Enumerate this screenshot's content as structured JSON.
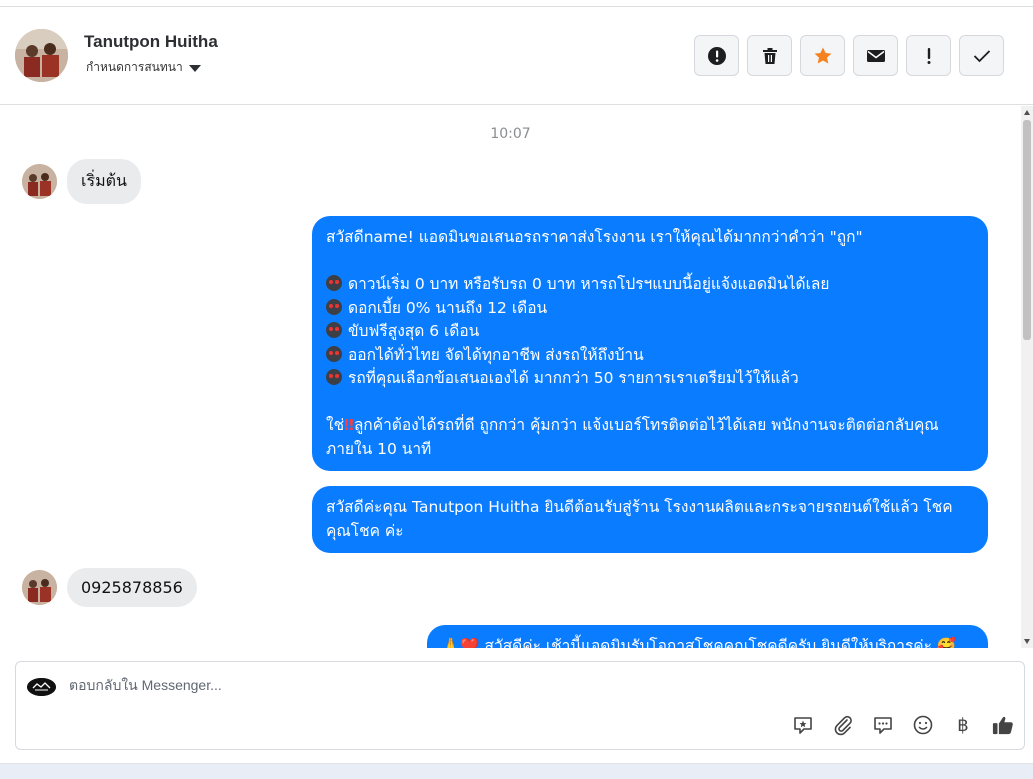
{
  "header": {
    "contact_name": "Tanutpon Huitha",
    "conversation_setting": "กำหนดการสนทนา",
    "actions": [
      {
        "name": "report-icon"
      },
      {
        "name": "trash-icon"
      },
      {
        "name": "star-icon",
        "color": "#f5821f"
      },
      {
        "name": "mail-icon"
      },
      {
        "name": "important-icon"
      },
      {
        "name": "check-icon"
      }
    ]
  },
  "thread": {
    "timestamp": "10:07",
    "messages": [
      {
        "direction": "in",
        "text": "เริ่มต้น"
      },
      {
        "direction": "out",
        "lines": [
          "สวัสดีname! แอดมินขอเสนอรถราคาส่งโรงงาน เราให้คุณได้มากกว่าคำว่า \"ถูก\"",
          "",
          "ดาวน์เริ่ม 0 บาท หรือรับรถ 0 บาท หารถโปรฯแบบนี้อยู่แจ้งแอดมินได้เลย",
          "ดอกเบี้ย 0% นานถึง 12 เดือน",
          "ขับฟรีสูงสุด 6 เดือน",
          "ออกได้ทั่วไทย จัดได้ทุกอาชีพ ส่งรถให้ถึงบ้าน",
          "รถที่คุณเลือกข้อเสนอเองได้ มากกว่า 50 รายการเราเตรียมไว้ให้แล้ว",
          "",
          "ใช่",
          "ลูกค้าต้องได้รถที่ดี ถูกกว่า คุ้มกว่า แจ้งเบอร์โทรติดต่อไว้ได้เลย พนักงานจะติดต่อกลับคุณภายใน 10 นาที"
        ],
        "exclaim": "‼"
      },
      {
        "direction": "out",
        "text": "สวัสดีค่ะคุณ Tanutpon Huitha ยินดีต้อนรับสู่ร้าน โรงงานผลิตและกระจายรถยนต์ใช้แล้ว โชคคุณโชค ค่ะ"
      },
      {
        "direction": "in",
        "text": "0925878856"
      },
      {
        "direction": "out",
        "text": "🙏❤️ สวัสดีค่ะ เช้านี้แอดมินรับโอกาสโชคคุณโชคดีครับ ยินดีให้บริการค่ะ 🥰"
      }
    ]
  },
  "composer": {
    "placeholder": "ตอบกลับใน Messenger...",
    "tools": [
      "saved-reply-icon",
      "attach-icon",
      "chat-icon",
      "emoji-icon",
      "baht-icon",
      "like-icon"
    ],
    "baht_symbol": "฿"
  },
  "colors": {
    "accent": "#0a7cff",
    "incoming_bubble": "#eaebed"
  }
}
